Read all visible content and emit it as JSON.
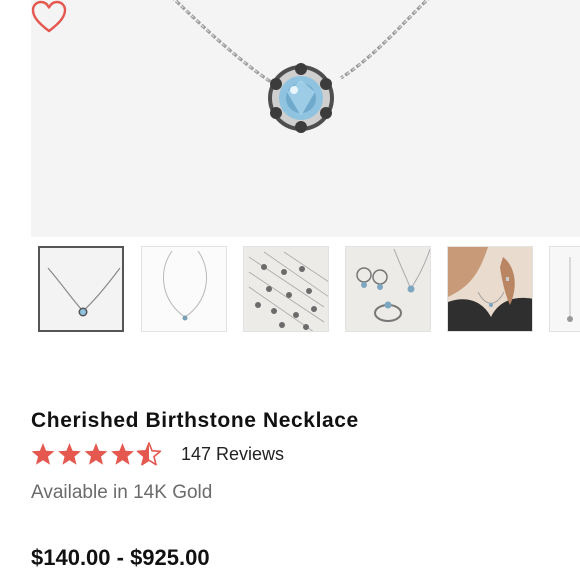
{
  "product": {
    "title": "Cherished Birthstone Necklace",
    "rating": 4.5,
    "rating_max": 5,
    "reviews_label": "147 Reviews",
    "availability": "Available in 14K Gold",
    "price_range": "$140.00 - $925.00"
  },
  "icons": {
    "wishlist": "heart-outline-icon",
    "star": "star-icon"
  },
  "thumbnails": [
    {
      "name": "thumbnail-necklace-closeup",
      "selected": true
    },
    {
      "name": "thumbnail-necklace-full",
      "selected": false
    },
    {
      "name": "thumbnail-birthstone-collection",
      "selected": false
    },
    {
      "name": "thumbnail-matching-set",
      "selected": false
    },
    {
      "name": "thumbnail-model-wearing",
      "selected": false
    },
    {
      "name": "thumbnail-more",
      "selected": false
    }
  ],
  "colors": {
    "star": "#e5584f",
    "heart": "#e5584f",
    "hero_background": "#f4f4f4",
    "gem": "#8fc3e0",
    "selected_border": "#555555"
  }
}
